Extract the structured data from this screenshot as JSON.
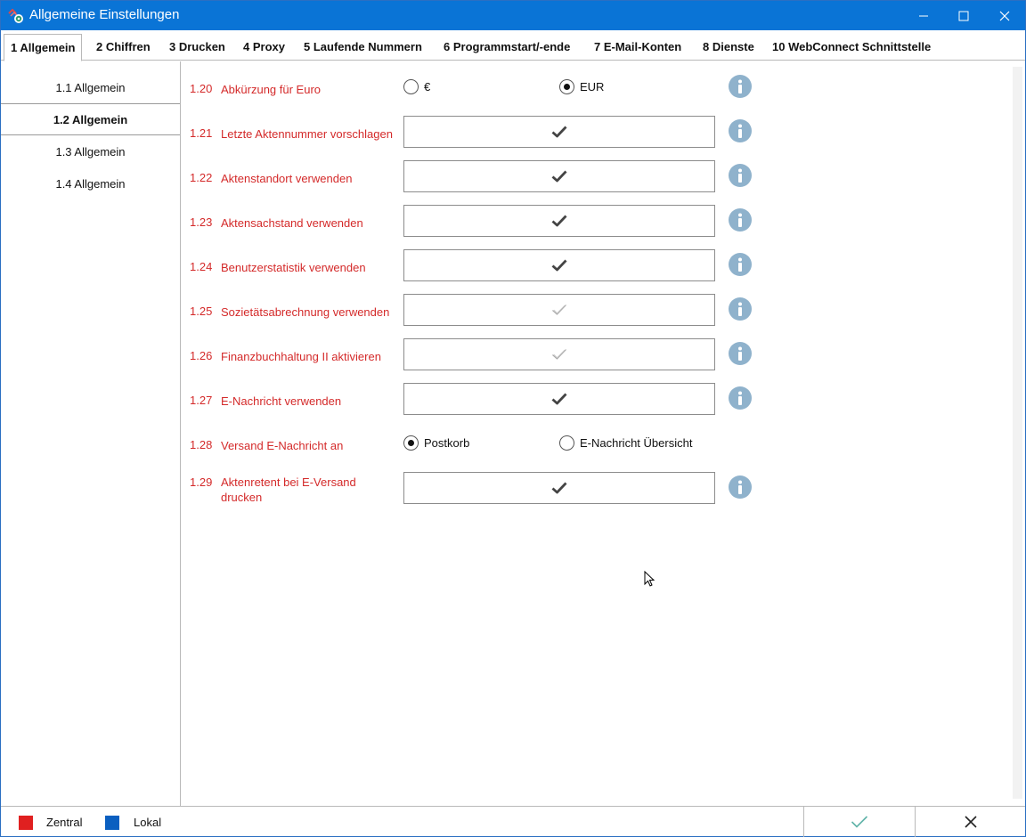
{
  "window": {
    "title": "Allgemeine Einstellungen"
  },
  "tabs": [
    {
      "label": "1 Allgemein",
      "active": true
    },
    {
      "label": "2 Chiffren"
    },
    {
      "label": "3 Drucken"
    },
    {
      "label": "4 Proxy"
    },
    {
      "label": "5 Laufende Nummern"
    },
    {
      "label": "6 Programmstart/-ende"
    },
    {
      "label": "7 E-Mail-Konten"
    },
    {
      "label": "8 Dienste"
    },
    {
      "label": "10 WebConnect Schnittstelle"
    }
  ],
  "nav": [
    {
      "label": "1.1 Allgemein"
    },
    {
      "label": "1.2 Allgemein",
      "active": true
    },
    {
      "label": "1.3 Allgemein"
    },
    {
      "label": "1.4 Allgemein"
    }
  ],
  "settings": [
    {
      "num": "1.20",
      "label": "Abkürzung für Euro",
      "kind": "radio",
      "options": [
        {
          "label": "€",
          "selected": false
        },
        {
          "label": "EUR",
          "selected": true
        }
      ],
      "info": true
    },
    {
      "num": "1.21",
      "label": "Letzte Aktennummer vorschlagen",
      "kind": "check",
      "state": "checked",
      "info": true
    },
    {
      "num": "1.22",
      "label": "Aktenstandort verwenden",
      "kind": "check",
      "state": "checked",
      "info": true
    },
    {
      "num": "1.23",
      "label": "Aktensachstand verwenden",
      "kind": "check",
      "state": "checked",
      "info": true
    },
    {
      "num": "1.24",
      "label": "Benutzerstatistik verwenden",
      "kind": "check",
      "state": "checked",
      "info": true
    },
    {
      "num": "1.25",
      "label": "Sozietätsabrechnung verwenden",
      "kind": "check",
      "state": "unchecked",
      "info": true
    },
    {
      "num": "1.26",
      "label": "Finanzbuchhaltung II aktivieren",
      "kind": "check",
      "state": "unchecked",
      "info": true
    },
    {
      "num": "1.27",
      "label": "E-Nachricht verwenden",
      "kind": "check",
      "state": "checked",
      "info": true
    },
    {
      "num": "1.28",
      "label": "Versand E-Nachricht an",
      "kind": "radio",
      "options": [
        {
          "label": "Postkorb",
          "selected": true
        },
        {
          "label": "E-Nachricht Übersicht",
          "selected": false
        }
      ],
      "info": false
    },
    {
      "num": "1.29",
      "label": "Aktenretent bei E-Versand drucken",
      "kind": "check",
      "state": "checked",
      "info": true
    }
  ],
  "legend": [
    {
      "label": "Zentral",
      "color": "#e02020"
    },
    {
      "label": "Lokal",
      "color": "#0a5fc0"
    }
  ],
  "colors": {
    "titlebar": "#0a74d6",
    "setting_label": "#d42a2a",
    "info_icon": "#8fb2cc",
    "ok_check": "#5fb3a8"
  },
  "icons": {
    "app": "settings-gear-icon",
    "info": "info-icon",
    "ok": "checkmark-icon",
    "cancel": "close-icon"
  }
}
